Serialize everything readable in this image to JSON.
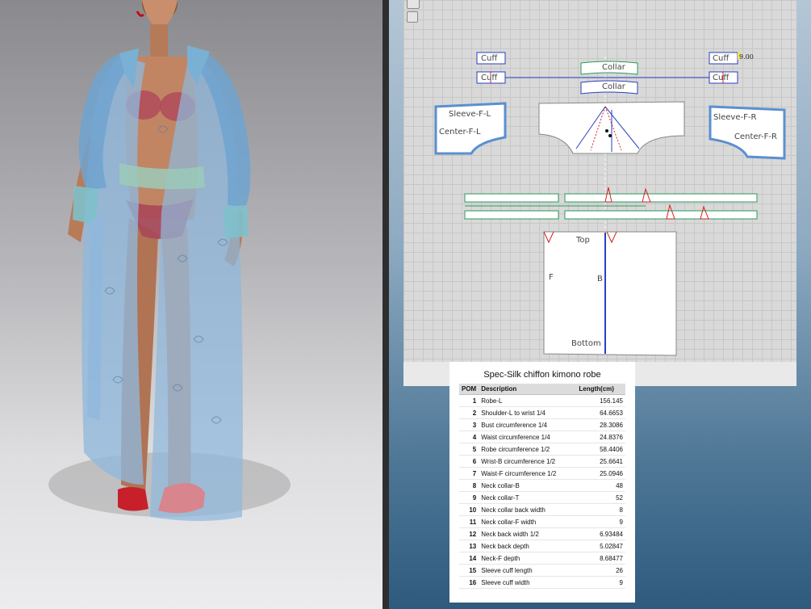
{
  "pattern": {
    "pieces": {
      "cuff_top_left": "Cuff",
      "cuff_bottom_left": "Cuff",
      "collar_top": "Collar",
      "collar_bottom": "Collar",
      "cuff_top_right": "Cuff",
      "cuff_bottom_right": "Cuff",
      "sleeve_left": "Sleeve-F-L",
      "center_left": "Center-F-L",
      "sleeve_right": "Sleeve-F-R",
      "center_right": "Center-F-R",
      "robe_top": "Top",
      "robe_front": "F",
      "robe_back": "B",
      "robe_bottom": "Bottom"
    },
    "measure_label": "9.00"
  },
  "spec": {
    "title": "Spec-Silk chiffon kimono robe",
    "columns": [
      "POM",
      "Description",
      "Length(cm)"
    ],
    "rows": [
      {
        "pom": "1",
        "desc": "Robe-L",
        "len": "156.145"
      },
      {
        "pom": "2",
        "desc": "Shoulder-L to wrist 1/4",
        "len": "64.6653"
      },
      {
        "pom": "3",
        "desc": "Bust circumference 1/4",
        "len": "28.3086"
      },
      {
        "pom": "4",
        "desc": "Waist circumference 1/4",
        "len": "24.8376"
      },
      {
        "pom": "5",
        "desc": "Robe circumference 1/2",
        "len": "58.4406"
      },
      {
        "pom": "6",
        "desc": "Wrist-B circumference 1/2",
        "len": "25.6641"
      },
      {
        "pom": "7",
        "desc": "Waist-F circumference 1/2",
        "len": "25.0946"
      },
      {
        "pom": "8",
        "desc": "Neck collar-B",
        "len": "48"
      },
      {
        "pom": "9",
        "desc": "Neck collar-T",
        "len": "52"
      },
      {
        "pom": "10",
        "desc": "Neck collar back width",
        "len": "8"
      },
      {
        "pom": "11",
        "desc": "Neck collar-F width",
        "len": "9"
      },
      {
        "pom": "12",
        "desc": "Neck back width 1/2",
        "len": "6.93484"
      },
      {
        "pom": "13",
        "desc": "Neck back depth",
        "len": "5.02847"
      },
      {
        "pom": "14",
        "desc": "Neck-F depth",
        "len": "8.68477"
      },
      {
        "pom": "15",
        "desc": "Sleeve cuff length",
        "len": "26"
      },
      {
        "pom": "16",
        "desc": "Sleeve cuff width",
        "len": "9"
      }
    ]
  },
  "colors": {
    "robe": "#8fb8dc",
    "pattern_bg": "#d9d9d9",
    "seam_blue": "#2a3fbf",
    "notch_red": "#d42020"
  }
}
